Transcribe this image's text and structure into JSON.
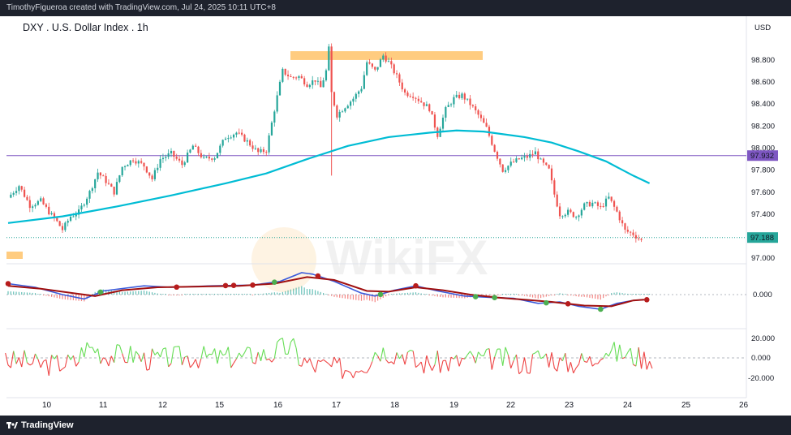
{
  "header": {
    "attribution": "TimothyFigueroa created with TradingView.com, Jul 24, 2025 10:11 UTC+8"
  },
  "footer": {
    "brand": "TradingView"
  },
  "watermark": "WikiFX",
  "chart_data": {
    "type": "candlestick",
    "title": "DXY . U.S. Dollar Index . 1h",
    "currency": "USD",
    "x_tick_labels": [
      "10",
      "11",
      "12",
      "15",
      "16",
      "17",
      "18",
      "19",
      "22",
      "23",
      "24",
      "25",
      "26"
    ],
    "price_axis": {
      "ylim": [
        96.95,
        99.05
      ],
      "tick_labels": [
        "98.800",
        "98.600",
        "98.400",
        "98.200",
        "98.000",
        "97.800",
        "97.600",
        "97.400",
        "97.000"
      ]
    },
    "price_line": {
      "value": 97.932,
      "label": "97.932",
      "color": "#7e57c2"
    },
    "last_price": {
      "value": 97.188,
      "label": "97.188",
      "color": "#26a69a"
    },
    "highlight_zone": {
      "from": 98.8,
      "to": 98.88,
      "color": "#ffcc80"
    },
    "close_path": [
      [
        0,
        97.55
      ],
      [
        4,
        97.66
      ],
      [
        8,
        97.48
      ],
      [
        12,
        97.52
      ],
      [
        15,
        97.42
      ],
      [
        18,
        97.33
      ],
      [
        20,
        97.26
      ],
      [
        23,
        97.38
      ],
      [
        26,
        97.42
      ],
      [
        30,
        97.6
      ],
      [
        33,
        97.78
      ],
      [
        36,
        97.7
      ],
      [
        39,
        97.6
      ],
      [
        42,
        97.83
      ],
      [
        46,
        97.9
      ],
      [
        50,
        97.84
      ],
      [
        53,
        97.72
      ],
      [
        56,
        97.9
      ],
      [
        60,
        97.95
      ],
      [
        64,
        97.85
      ],
      [
        68,
        98.02
      ],
      [
        72,
        97.9
      ],
      [
        76,
        97.92
      ],
      [
        80,
        98.1
      ],
      [
        84,
        98.14
      ],
      [
        88,
        98.06
      ],
      [
        92,
        97.96
      ],
      [
        95,
        97.98
      ],
      [
        98,
        98.35
      ],
      [
        101,
        98.7
      ],
      [
        104,
        98.64
      ],
      [
        107,
        98.65
      ],
      [
        110,
        98.58
      ],
      [
        113,
        98.62
      ],
      [
        115,
        98.55
      ],
      [
        117,
        98.7
      ],
      [
        118,
        98.9
      ],
      [
        119,
        98.5
      ],
      [
        121,
        98.3
      ],
      [
        124,
        98.38
      ],
      [
        127,
        98.45
      ],
      [
        130,
        98.55
      ],
      [
        132,
        98.78
      ],
      [
        135,
        98.7
      ],
      [
        138,
        98.84
      ],
      [
        140,
        98.78
      ],
      [
        143,
        98.65
      ],
      [
        146,
        98.5
      ],
      [
        149,
        98.48
      ],
      [
        152,
        98.42
      ],
      [
        155,
        98.36
      ],
      [
        158,
        98.12
      ],
      [
        161,
        98.35
      ],
      [
        164,
        98.45
      ],
      [
        167,
        98.48
      ],
      [
        170,
        98.4
      ],
      [
        173,
        98.3
      ],
      [
        176,
        98.18
      ],
      [
        179,
        97.98
      ],
      [
        182,
        97.8
      ],
      [
        185,
        97.86
      ],
      [
        188,
        97.9
      ],
      [
        191,
        97.92
      ],
      [
        194,
        97.96
      ],
      [
        196,
        97.88
      ],
      [
        199,
        97.8
      ],
      [
        201,
        97.58
      ],
      [
        203,
        97.4
      ],
      [
        206,
        97.42
      ],
      [
        209,
        97.38
      ],
      [
        212,
        97.48
      ],
      [
        215,
        97.5
      ],
      [
        218,
        97.46
      ],
      [
        221,
        97.55
      ],
      [
        224,
        97.42
      ],
      [
        227,
        97.25
      ],
      [
        230,
        97.22
      ],
      [
        233,
        97.16
      ]
    ],
    "moving_average": [
      [
        0,
        97.32
      ],
      [
        20,
        97.38
      ],
      [
        40,
        97.47
      ],
      [
        60,
        97.57
      ],
      [
        80,
        97.68
      ],
      [
        95,
        97.77
      ],
      [
        110,
        97.9
      ],
      [
        125,
        98.02
      ],
      [
        140,
        98.1
      ],
      [
        155,
        98.14
      ],
      [
        165,
        98.16
      ],
      [
        175,
        98.15
      ],
      [
        190,
        98.1
      ],
      [
        200,
        98.05
      ],
      [
        210,
        97.97
      ],
      [
        220,
        97.88
      ],
      [
        230,
        97.75
      ],
      [
        236,
        97.68
      ]
    ],
    "macd_axis": {
      "tick_labels": [
        "0.000"
      ]
    },
    "macd_line": [
      [
        0,
        0.15
      ],
      [
        10,
        0.1
      ],
      [
        20,
        0.0
      ],
      [
        28,
        -0.06
      ],
      [
        35,
        0.05
      ],
      [
        50,
        0.12
      ],
      [
        60,
        0.1
      ],
      [
        75,
        0.12
      ],
      [
        90,
        0.13
      ],
      [
        100,
        0.18
      ],
      [
        108,
        0.3
      ],
      [
        112,
        0.28
      ],
      [
        120,
        0.18
      ],
      [
        130,
        0.02
      ],
      [
        135,
        -0.02
      ],
      [
        142,
        0.06
      ],
      [
        150,
        0.12
      ],
      [
        158,
        0.05
      ],
      [
        168,
        -0.02
      ],
      [
        178,
        -0.04
      ],
      [
        186,
        -0.05
      ],
      [
        195,
        -0.12
      ],
      [
        203,
        -0.1
      ],
      [
        210,
        -0.16
      ],
      [
        218,
        -0.2
      ],
      [
        224,
        -0.12
      ],
      [
        230,
        -0.08
      ],
      [
        234,
        -0.07
      ]
    ],
    "macd_signal": [
      [
        0,
        0.12
      ],
      [
        12,
        0.08
      ],
      [
        24,
        0.02
      ],
      [
        32,
        -0.02
      ],
      [
        42,
        0.06
      ],
      [
        55,
        0.1
      ],
      [
        70,
        0.11
      ],
      [
        85,
        0.12
      ],
      [
        98,
        0.15
      ],
      [
        110,
        0.24
      ],
      [
        120,
        0.2
      ],
      [
        132,
        0.05
      ],
      [
        140,
        0.04
      ],
      [
        150,
        0.1
      ],
      [
        160,
        0.06
      ],
      [
        170,
        0.0
      ],
      [
        180,
        -0.04
      ],
      [
        190,
        -0.07
      ],
      [
        200,
        -0.1
      ],
      [
        212,
        -0.15
      ],
      [
        222,
        -0.16
      ],
      [
        230,
        -0.08
      ],
      [
        234,
        -0.07
      ]
    ],
    "macd_cross_markers": {
      "up_color": "#4caf50",
      "down_color": "#b71c1c"
    },
    "osc_axis": {
      "tick_labels": [
        "20.000",
        "0.000",
        "-20.000"
      ],
      "ylim": [
        -32,
        28
      ]
    },
    "osc_above_color": "#66dd55",
    "osc_below_color": "#ee4444"
  },
  "colors": {
    "up_candle": "#26a69a",
    "down_candle": "#ef5350",
    "moving_average": "#00bcd4",
    "macd_line": "#3b5bdb",
    "signal_line": "#a01010"
  }
}
